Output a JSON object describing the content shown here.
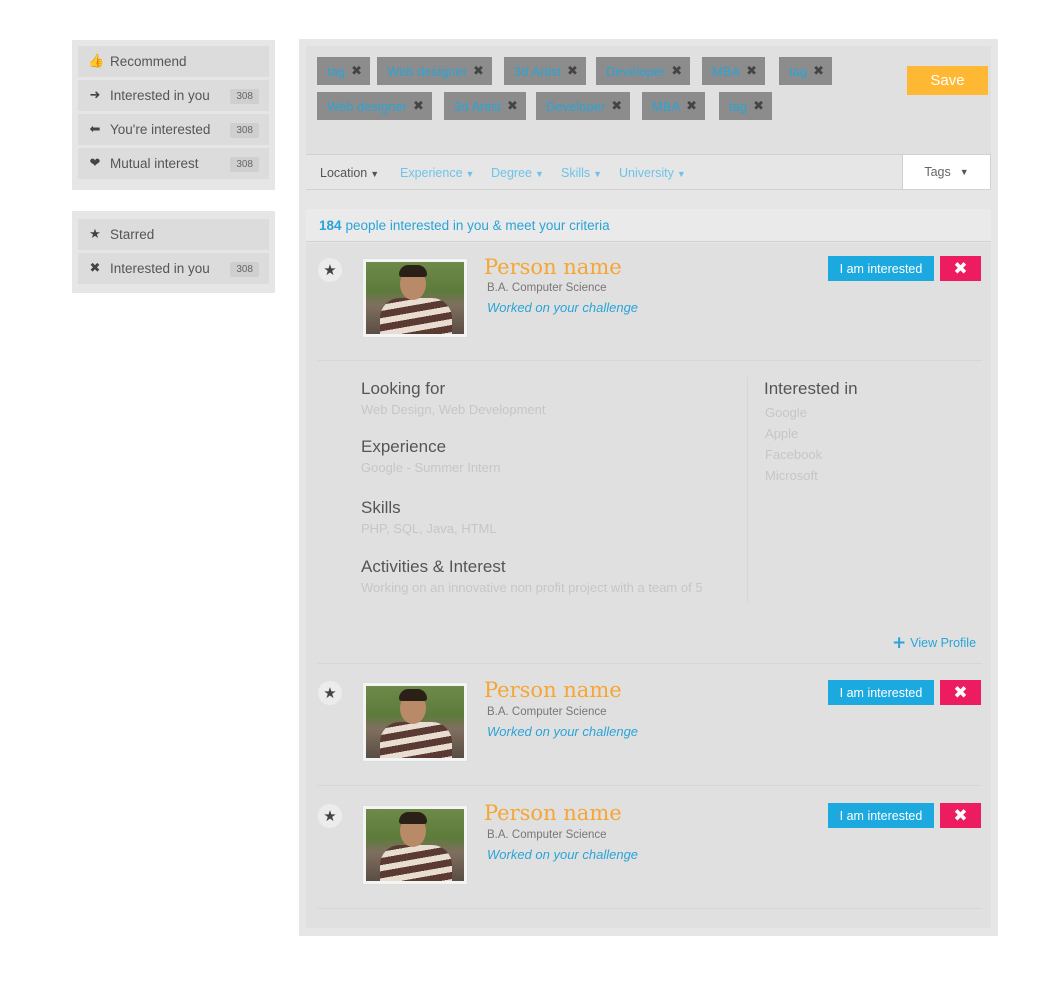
{
  "sidebar": {
    "group1": [
      {
        "icon": "thumbs-up-icon",
        "glyph": "👍",
        "label": "Recommend",
        "count": ""
      },
      {
        "icon": "arrow-right-icon",
        "glyph": "➜",
        "label": "Interested in you",
        "count": "308"
      },
      {
        "icon": "arrow-left-icon",
        "glyph": "⬅",
        "label": "You're interested",
        "count": "308"
      },
      {
        "icon": "heart-icon",
        "glyph": "❤",
        "label": "Mutual interest",
        "count": "308"
      }
    ],
    "group2": [
      {
        "icon": "star-icon",
        "glyph": "★",
        "label": "Starred",
        "count": ""
      },
      {
        "icon": "close-icon",
        "glyph": "✖",
        "label": "Interested in you",
        "count": "308"
      }
    ]
  },
  "tags": [
    {
      "label": "tag"
    },
    {
      "label": "Web designer"
    },
    {
      "label": "3d Artist"
    },
    {
      "label": "Developer"
    },
    {
      "label": "MBA"
    },
    {
      "label": "tag"
    },
    {
      "label": "Web designer"
    },
    {
      "label": "3d Artist"
    },
    {
      "label": "Developer"
    },
    {
      "label": "MBA"
    },
    {
      "label": "tag"
    }
  ],
  "save_label": "Save",
  "filters": {
    "location": "Location",
    "experience": "Experience",
    "degree": "Degree",
    "skills": "Skills",
    "university": "University",
    "tags": "Tags",
    "caret": "▼"
  },
  "count": {
    "number": "184",
    "text": "people interested in you & meet your criteria"
  },
  "people": [
    {
      "name": "Person name",
      "degree": "B.A. Computer Science",
      "challenge": "Worked on your challenge"
    },
    {
      "name": "Person name",
      "degree": "B.A. Computer Science",
      "challenge": "Worked on your challenge"
    },
    {
      "name": "Person name",
      "degree": "B.A. Computer Science",
      "challenge": "Worked on your challenge"
    }
  ],
  "buttons": {
    "interested": "I am interested",
    "reject_glyph": "✖",
    "star_glyph": "★"
  },
  "details": {
    "looking_for": {
      "title": "Looking for",
      "value": "Web Design, Web Development"
    },
    "experience": {
      "title": "Experience",
      "value": "Google - Summer Intern"
    },
    "skills": {
      "title": "Skills",
      "value": "PHP, SQL, Java, HTML"
    },
    "activities": {
      "title": "Activities & Interest",
      "value": "Working on an innovative non profit project with a team of 5"
    },
    "interested_in": {
      "title": "Interested in",
      "items": [
        "Google",
        "Apple",
        "Facebook",
        "Microsoft"
      ]
    },
    "view_profile": "View Profile",
    "plus_glyph": "+"
  },
  "colors": {
    "accent_blue": "#1ba9e0",
    "save_orange": "#ffb833",
    "reject_pink": "#ed1b5f",
    "name_orange": "#f5a634"
  }
}
